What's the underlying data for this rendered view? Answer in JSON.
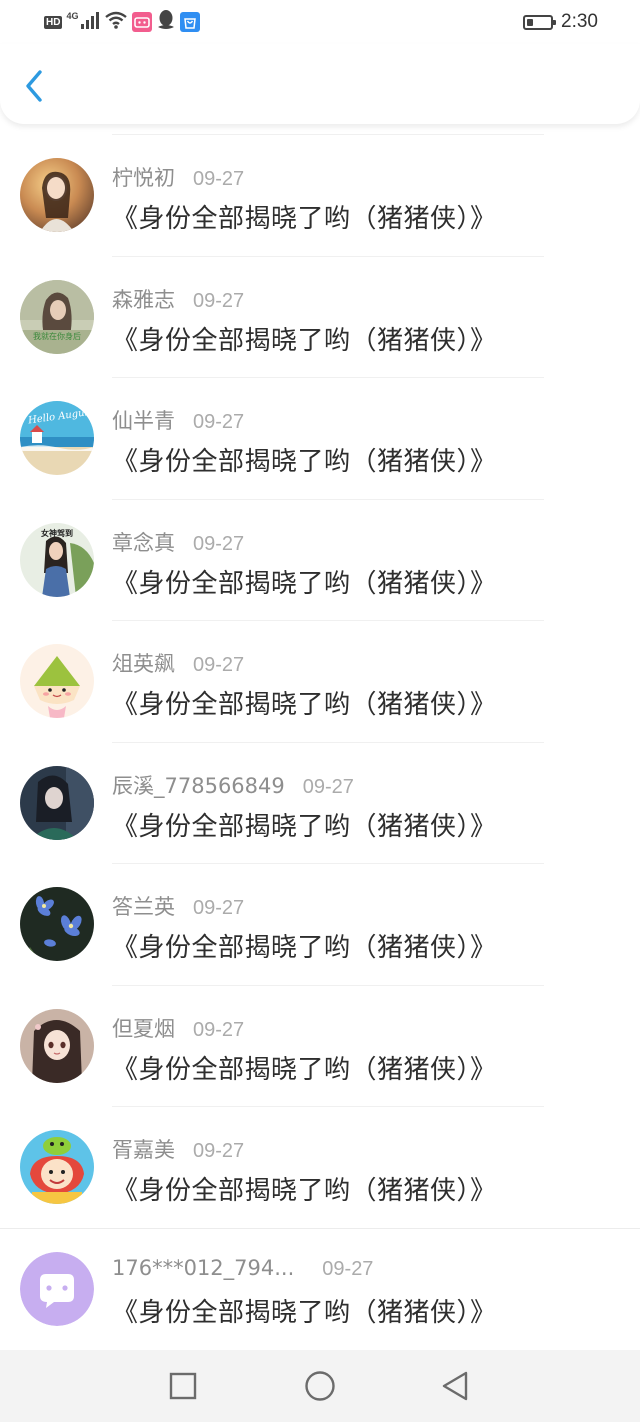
{
  "status_bar": {
    "network_badge": "HD",
    "network_type": "4G",
    "time": "2:30",
    "battery_level_percent": 25,
    "icons": [
      "signal-icon",
      "wifi-icon",
      "bilibili-app-icon",
      "qq-icon",
      "shopping-bag-icon",
      "battery-icon"
    ]
  },
  "header": {
    "back_icon": "chevron-left-icon",
    "accent_color": "#2d9ae0"
  },
  "messages": [
    {
      "username": "柠悦初",
      "date": "09-27",
      "text": "《身份全部揭晓了哟（猪猪侠）》"
    },
    {
      "username": "森雅志",
      "date": "09-27",
      "text": "《身份全部揭晓了哟（猪猪侠）》",
      "avatar_caption": "我就在你身后"
    },
    {
      "username": "仙半青",
      "date": "09-27",
      "text": "《身份全部揭晓了哟（猪猪侠）》",
      "avatar_caption": "Hello August"
    },
    {
      "username": "章念真",
      "date": "09-27",
      "text": "《身份全部揭晓了哟（猪猪侠）》",
      "avatar_caption": "女神驾到"
    },
    {
      "username": "俎英飙",
      "date": "09-27",
      "text": "《身份全部揭晓了哟（猪猪侠）》"
    },
    {
      "username": "辰溪_778566849",
      "date": "09-27",
      "text": "《身份全部揭晓了哟（猪猪侠）》"
    },
    {
      "username": "答兰英",
      "date": "09-27",
      "text": "《身份全部揭晓了哟（猪猪侠）》"
    },
    {
      "username": "但夏烟",
      "date": "09-27",
      "text": "《身份全部揭晓了哟（猪猪侠）》"
    },
    {
      "username": "胥嘉美",
      "date": "09-27",
      "text": "《身份全部揭晓了哟（猪猪侠）》"
    },
    {
      "username": "176***012_794...",
      "date": "09-27",
      "text": "《身份全部揭晓了哟（猪猪侠）》"
    }
  ],
  "nav_bar": {
    "icons": [
      "recent-apps-icon",
      "home-icon",
      "back-triangle-icon"
    ]
  }
}
